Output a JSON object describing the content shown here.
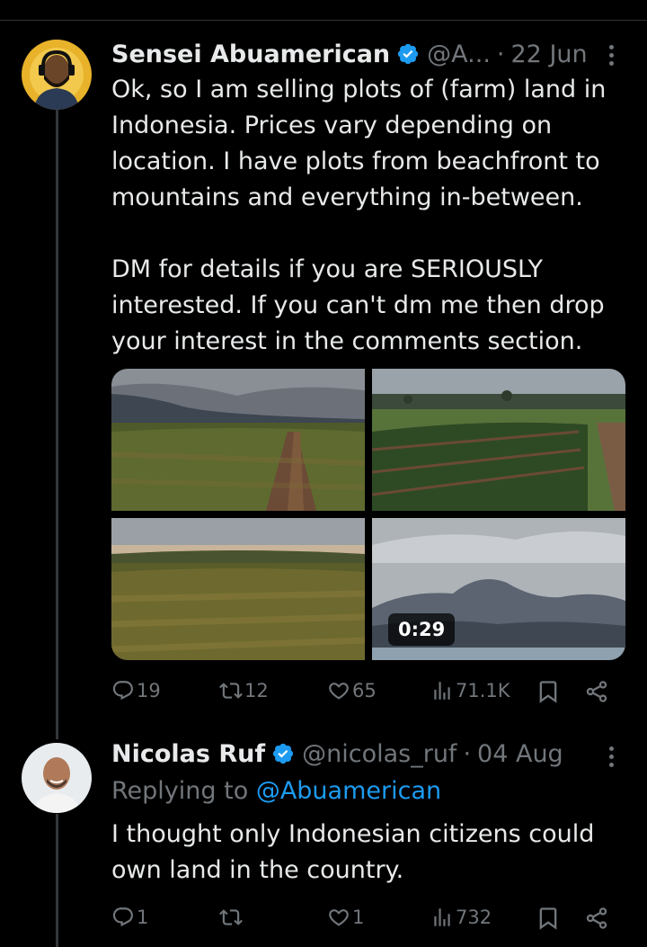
{
  "colors": {
    "background": "#000000",
    "text": "#e7e9ea",
    "muted": "#71767b",
    "accent": "#1d9bf0",
    "divider": "#2f3336"
  },
  "tweet1": {
    "author_name": "Sensei Abuamerican",
    "handle": "@A...",
    "separator": "·",
    "date": "22 Jun",
    "text": "Ok, so I am selling plots of (farm) land in Indonesia. Prices vary depending on location. I have plots from beachfront to mountains and everything in-between.\n\nDM for details if you are SERIOUSLY interested. If you can't dm me then drop your interest in the comments section.",
    "media": {
      "video_duration": "0:29"
    },
    "stats": {
      "replies": "19",
      "reposts": "12",
      "likes": "65",
      "views": "71.1K"
    },
    "icons": [
      "verified-badge-icon",
      "more-icon",
      "reply-icon",
      "repost-icon",
      "like-icon",
      "views-icon",
      "bookmark-icon",
      "share-icon"
    ]
  },
  "tweet2": {
    "author_name": "Nicolas Ruf",
    "handle": "@nicolas_ruf",
    "separator": "·",
    "date": "04 Aug",
    "replying_label": "Replying to",
    "replying_to": "@Abuamerican",
    "text": "I thought only Indonesian citizens could own land in the country.",
    "stats": {
      "replies": "1",
      "reposts": "",
      "likes": "1",
      "views": "732"
    }
  }
}
